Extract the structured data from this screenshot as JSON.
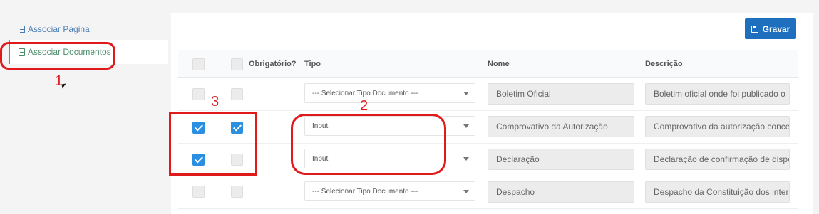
{
  "sidebar": {
    "items": [
      {
        "label": "Associar Página",
        "icon": "document-icon"
      },
      {
        "label": "Associar Documentos",
        "icon": "document-icon",
        "active": true
      }
    ]
  },
  "toolbar": {
    "save_label": "Gravar",
    "save_icon": "floppy-disk-icon",
    "accent_color": "#1f6fbf"
  },
  "table": {
    "headers": {
      "obrigatorio": "Obrigatório?",
      "tipo": "Tipo",
      "nome": "Nome",
      "descricao": "Descrição"
    },
    "rows": [
      {
        "selected": false,
        "obrigatorio": false,
        "tipo": "--- Selecionar Tipo Documento ---",
        "nome": "Boletim Oficial",
        "descricao": "Boletim oficial onde foi publicado o"
      },
      {
        "selected": true,
        "obrigatorio": true,
        "tipo": "Input",
        "nome": "Comprovativo da Autorização",
        "descricao": "Comprovativo da autorização conce"
      },
      {
        "selected": true,
        "obrigatorio": false,
        "tipo": "Input",
        "nome": "Declaração",
        "descricao": "Declaração de confirmação de dispo"
      },
      {
        "selected": false,
        "obrigatorio": false,
        "tipo": "--- Selecionar Tipo Documento ---",
        "nome": "Despacho",
        "descricao": "Despacho da Constituição dos inter"
      }
    ]
  },
  "annotations": {
    "label1": "1",
    "label2": "2",
    "label3": "3",
    "color": "#e0191b"
  }
}
